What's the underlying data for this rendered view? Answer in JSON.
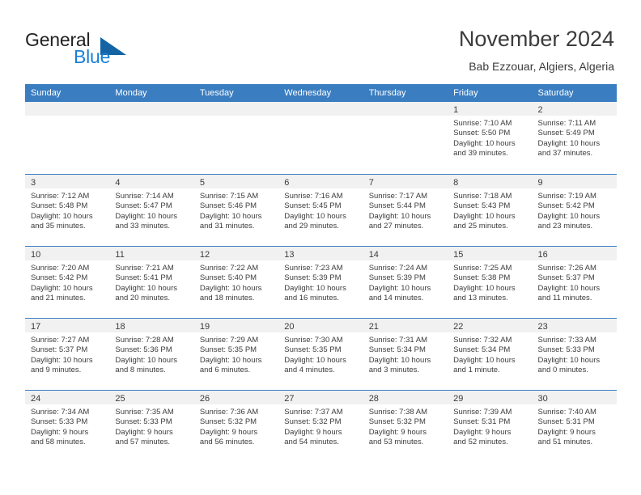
{
  "logo": {
    "word_top": "General",
    "word_bottom": "Blue",
    "triangle_color": "#1464a5",
    "blue_color": "#1a7fd4"
  },
  "header": {
    "title": "November 2024",
    "subtitle": "Bab Ezzouar, Algiers, Algeria"
  },
  "theme": {
    "header_blue": "#3a7dc0",
    "day_strip_gray": "#f1f1f1",
    "text_color": "#3c3c3c"
  },
  "weekdays": [
    "Sunday",
    "Monday",
    "Tuesday",
    "Wednesday",
    "Thursday",
    "Friday",
    "Saturday"
  ],
  "weeks": [
    [
      {
        "day": "",
        "empty": true
      },
      {
        "day": "",
        "empty": true
      },
      {
        "day": "",
        "empty": true
      },
      {
        "day": "",
        "empty": true
      },
      {
        "day": "",
        "empty": true
      },
      {
        "day": "1",
        "sunrise": "Sunrise: 7:10 AM",
        "sunset": "Sunset: 5:50 PM",
        "daylight_1": "Daylight: 10 hours",
        "daylight_2": "and 39 minutes."
      },
      {
        "day": "2",
        "sunrise": "Sunrise: 7:11 AM",
        "sunset": "Sunset: 5:49 PM",
        "daylight_1": "Daylight: 10 hours",
        "daylight_2": "and 37 minutes."
      }
    ],
    [
      {
        "day": "3",
        "sunrise": "Sunrise: 7:12 AM",
        "sunset": "Sunset: 5:48 PM",
        "daylight_1": "Daylight: 10 hours",
        "daylight_2": "and 35 minutes."
      },
      {
        "day": "4",
        "sunrise": "Sunrise: 7:14 AM",
        "sunset": "Sunset: 5:47 PM",
        "daylight_1": "Daylight: 10 hours",
        "daylight_2": "and 33 minutes."
      },
      {
        "day": "5",
        "sunrise": "Sunrise: 7:15 AM",
        "sunset": "Sunset: 5:46 PM",
        "daylight_1": "Daylight: 10 hours",
        "daylight_2": "and 31 minutes."
      },
      {
        "day": "6",
        "sunrise": "Sunrise: 7:16 AM",
        "sunset": "Sunset: 5:45 PM",
        "daylight_1": "Daylight: 10 hours",
        "daylight_2": "and 29 minutes."
      },
      {
        "day": "7",
        "sunrise": "Sunrise: 7:17 AM",
        "sunset": "Sunset: 5:44 PM",
        "daylight_1": "Daylight: 10 hours",
        "daylight_2": "and 27 minutes."
      },
      {
        "day": "8",
        "sunrise": "Sunrise: 7:18 AM",
        "sunset": "Sunset: 5:43 PM",
        "daylight_1": "Daylight: 10 hours",
        "daylight_2": "and 25 minutes."
      },
      {
        "day": "9",
        "sunrise": "Sunrise: 7:19 AM",
        "sunset": "Sunset: 5:42 PM",
        "daylight_1": "Daylight: 10 hours",
        "daylight_2": "and 23 minutes."
      }
    ],
    [
      {
        "day": "10",
        "sunrise": "Sunrise: 7:20 AM",
        "sunset": "Sunset: 5:42 PM",
        "daylight_1": "Daylight: 10 hours",
        "daylight_2": "and 21 minutes."
      },
      {
        "day": "11",
        "sunrise": "Sunrise: 7:21 AM",
        "sunset": "Sunset: 5:41 PM",
        "daylight_1": "Daylight: 10 hours",
        "daylight_2": "and 20 minutes."
      },
      {
        "day": "12",
        "sunrise": "Sunrise: 7:22 AM",
        "sunset": "Sunset: 5:40 PM",
        "daylight_1": "Daylight: 10 hours",
        "daylight_2": "and 18 minutes."
      },
      {
        "day": "13",
        "sunrise": "Sunrise: 7:23 AM",
        "sunset": "Sunset: 5:39 PM",
        "daylight_1": "Daylight: 10 hours",
        "daylight_2": "and 16 minutes."
      },
      {
        "day": "14",
        "sunrise": "Sunrise: 7:24 AM",
        "sunset": "Sunset: 5:39 PM",
        "daylight_1": "Daylight: 10 hours",
        "daylight_2": "and 14 minutes."
      },
      {
        "day": "15",
        "sunrise": "Sunrise: 7:25 AM",
        "sunset": "Sunset: 5:38 PM",
        "daylight_1": "Daylight: 10 hours",
        "daylight_2": "and 13 minutes."
      },
      {
        "day": "16",
        "sunrise": "Sunrise: 7:26 AM",
        "sunset": "Sunset: 5:37 PM",
        "daylight_1": "Daylight: 10 hours",
        "daylight_2": "and 11 minutes."
      }
    ],
    [
      {
        "day": "17",
        "sunrise": "Sunrise: 7:27 AM",
        "sunset": "Sunset: 5:37 PM",
        "daylight_1": "Daylight: 10 hours",
        "daylight_2": "and 9 minutes."
      },
      {
        "day": "18",
        "sunrise": "Sunrise: 7:28 AM",
        "sunset": "Sunset: 5:36 PM",
        "daylight_1": "Daylight: 10 hours",
        "daylight_2": "and 8 minutes."
      },
      {
        "day": "19",
        "sunrise": "Sunrise: 7:29 AM",
        "sunset": "Sunset: 5:35 PM",
        "daylight_1": "Daylight: 10 hours",
        "daylight_2": "and 6 minutes."
      },
      {
        "day": "20",
        "sunrise": "Sunrise: 7:30 AM",
        "sunset": "Sunset: 5:35 PM",
        "daylight_1": "Daylight: 10 hours",
        "daylight_2": "and 4 minutes."
      },
      {
        "day": "21",
        "sunrise": "Sunrise: 7:31 AM",
        "sunset": "Sunset: 5:34 PM",
        "daylight_1": "Daylight: 10 hours",
        "daylight_2": "and 3 minutes."
      },
      {
        "day": "22",
        "sunrise": "Sunrise: 7:32 AM",
        "sunset": "Sunset: 5:34 PM",
        "daylight_1": "Daylight: 10 hours",
        "daylight_2": "and 1 minute."
      },
      {
        "day": "23",
        "sunrise": "Sunrise: 7:33 AM",
        "sunset": "Sunset: 5:33 PM",
        "daylight_1": "Daylight: 10 hours",
        "daylight_2": "and 0 minutes."
      }
    ],
    [
      {
        "day": "24",
        "sunrise": "Sunrise: 7:34 AM",
        "sunset": "Sunset: 5:33 PM",
        "daylight_1": "Daylight: 9 hours",
        "daylight_2": "and 58 minutes."
      },
      {
        "day": "25",
        "sunrise": "Sunrise: 7:35 AM",
        "sunset": "Sunset: 5:33 PM",
        "daylight_1": "Daylight: 9 hours",
        "daylight_2": "and 57 minutes."
      },
      {
        "day": "26",
        "sunrise": "Sunrise: 7:36 AM",
        "sunset": "Sunset: 5:32 PM",
        "daylight_1": "Daylight: 9 hours",
        "daylight_2": "and 56 minutes."
      },
      {
        "day": "27",
        "sunrise": "Sunrise: 7:37 AM",
        "sunset": "Sunset: 5:32 PM",
        "daylight_1": "Daylight: 9 hours",
        "daylight_2": "and 54 minutes."
      },
      {
        "day": "28",
        "sunrise": "Sunrise: 7:38 AM",
        "sunset": "Sunset: 5:32 PM",
        "daylight_1": "Daylight: 9 hours",
        "daylight_2": "and 53 minutes."
      },
      {
        "day": "29",
        "sunrise": "Sunrise: 7:39 AM",
        "sunset": "Sunset: 5:31 PM",
        "daylight_1": "Daylight: 9 hours",
        "daylight_2": "and 52 minutes."
      },
      {
        "day": "30",
        "sunrise": "Sunrise: 7:40 AM",
        "sunset": "Sunset: 5:31 PM",
        "daylight_1": "Daylight: 9 hours",
        "daylight_2": "and 51 minutes."
      }
    ]
  ]
}
